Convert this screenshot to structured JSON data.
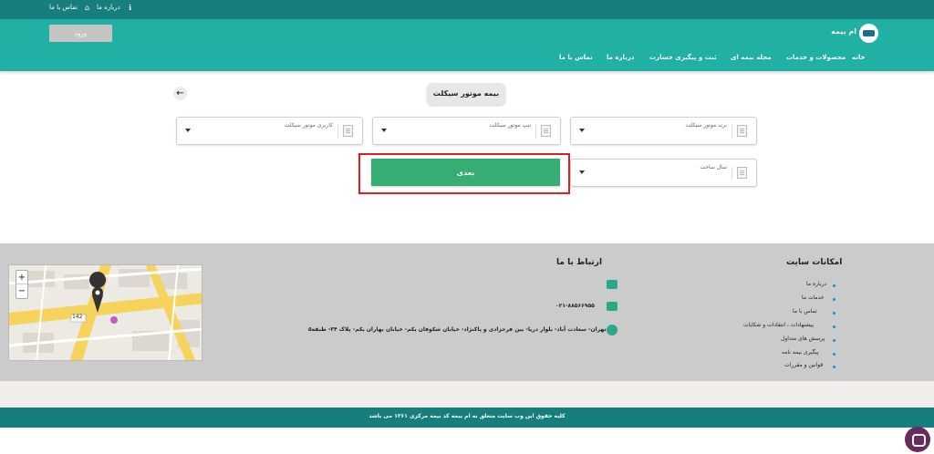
{
  "topbar": {
    "about": "درباره ما",
    "contact": "تماس با ما"
  },
  "header": {
    "brand": "ام بیمه",
    "login": "ورود",
    "nav": [
      "خانه",
      "محصولات و خدمات",
      "مجله بیمه ای",
      "ثبت و پیگیری خسارت",
      "درباره ما",
      "تماس با ما"
    ]
  },
  "page": {
    "title": "بیمه موتور سیکلت",
    "fields": {
      "brand": "برند موتور سیکلت",
      "type": "تیپ موتور سیکلت",
      "usage": "کاربری موتور سیکلت",
      "year": "سال ساخت"
    },
    "next": "بعدی"
  },
  "footer": {
    "features_title": "امکانات سایت",
    "features": [
      "درباره ما",
      "خدمات ما",
      "تماس با ما",
      "پیشنهادات ، انتقادات و شکایات",
      "پرسش های متداول",
      "پیگیری بیمه نامه",
      "قوانین و مقررات"
    ],
    "contact_title": "ارتباط با ما",
    "phone": "۰۲۱-۸۸۵۶۶۹۵۵",
    "address": "تهران- سعادت آباد- بلوار دریا- بین فرحزادی و پاکنژاد- خیابان شکوفان یکم- خیابان بهاران یکم- پلاک ۳۴- طبقه۵",
    "map_label": "142",
    "copyright": "کلیه حقوق این وب سایت متعلق به ام بیمه کد بیمه مرکزی ۱۲۶۱ می باشد"
  },
  "colors": {
    "topbar": "#177e7e",
    "header": "#21b0a4",
    "next_button": "#35ad73",
    "highlight": "#e02020",
    "footer": "#cbcbcb"
  }
}
